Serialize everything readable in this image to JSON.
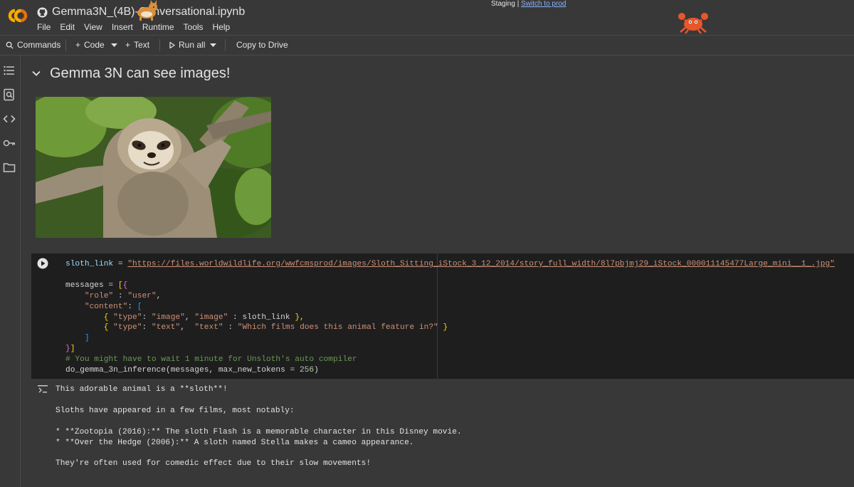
{
  "header": {
    "title": "Gemma3N_(4B)-Conversational.ipynb",
    "menu": [
      "File",
      "Edit",
      "View",
      "Insert",
      "Runtime",
      "Tools",
      "Help"
    ],
    "staging_text": "Staging |",
    "switch_link": "Switch to prod"
  },
  "toolbar": {
    "commands": "Commands",
    "code": "Code",
    "text": "Text",
    "run_all": "Run all",
    "copy_to_drive": "Copy to Drive"
  },
  "sidebar": {
    "icons": [
      "table-of-contents-icon",
      "find-icon",
      "code-snippets-icon",
      "secrets-key-icon",
      "files-folder-icon"
    ]
  },
  "notebook": {
    "heading": "Gemma 3N can see images!",
    "code_cell": {
      "l1_var": "sloth_link",
      "l1_eq": " = ",
      "l1_url": "\"https://files.worldwildlife.org/wwfcmsprod/images/Sloth_Sitting_iStock_3_12_2014/story_full_width/8l7pbjmj29_iStock_000011145477Large_mini__1_.jpg\"",
      "l3_a": "messages",
      "l3_b": " = ",
      "l3_c": "[",
      "l3_d": "{",
      "l4_a": "\"role\"",
      "l4_b": " : ",
      "l4_c": "\"user\"",
      "l4_d": ",",
      "l5_a": "\"content\"",
      "l5_b": ": ",
      "l5_c": "[",
      "l6_a": "{ ",
      "l6_b": "\"type\"",
      "l6_c": ": ",
      "l6_d": "\"image\"",
      "l6_e": ", ",
      "l6_f": "\"image\"",
      "l6_g": " : sloth_link ",
      "l6_h": "},",
      "l7_a": "{ ",
      "l7_b": "\"type\"",
      "l7_c": ": ",
      "l7_d": "\"text\"",
      "l7_e": ",  ",
      "l7_f": "\"text\"",
      "l7_g": " : ",
      "l7_h": "\"Which films does this animal feature in?\"",
      "l7_i": " }",
      "l8": "]",
      "l9_a": "}",
      "l9_b": "]",
      "l10": "# You might have to wait 1 minute for Unsloth's auto compiler",
      "l11_a": "do_gemma_3n_inference(messages, max_new_tokens = ",
      "l11_b": "256",
      "l11_c": ")"
    },
    "output": [
      "This adorable animal is a **sloth**!",
      "",
      "Sloths have appeared in a few films, most notably:",
      "",
      "* **Zootopia (2016):** The sloth Flash is a memorable character in this Disney movie.",
      "* **Over the Hedge (2006):** A sloth named Stella makes a cameo appearance.",
      "",
      "They're often used for comedic effect due to their slow movements!"
    ]
  },
  "colors": {
    "background": "#383838",
    "code_bg": "#1e1e1e",
    "string": "#ce9178",
    "comment": "#6a9955",
    "number": "#b5cea8",
    "link": "#8ab4f8",
    "colab_orange": "#f9ab00"
  }
}
